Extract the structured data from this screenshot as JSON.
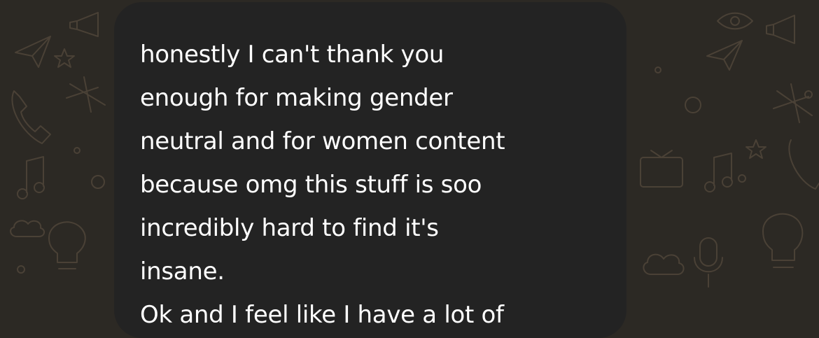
{
  "app": {
    "wallpaper_color": "#2c2924",
    "wallpaper_doodle_color": "#4a4136",
    "bubble_color": "#232323",
    "text_color": "#ffffff"
  },
  "message": {
    "lines": [
      "honestly I can't thank you",
      "enough for making gender",
      "neutral and for women content",
      "because omg this stuff is soo",
      "incredibly hard to find it's",
      "insane.",
      "Ok and I feel like I have a lot of"
    ]
  },
  "wallpaper": {
    "icons": [
      "paper-plane-icon",
      "phone-icon",
      "music-note-icon",
      "lightbulb-icon",
      "cloud-icon",
      "megaphone-icon",
      "eye-icon",
      "microphone-icon",
      "airplane-icon",
      "star-icon",
      "circle-icon",
      "tv-icon"
    ]
  }
}
